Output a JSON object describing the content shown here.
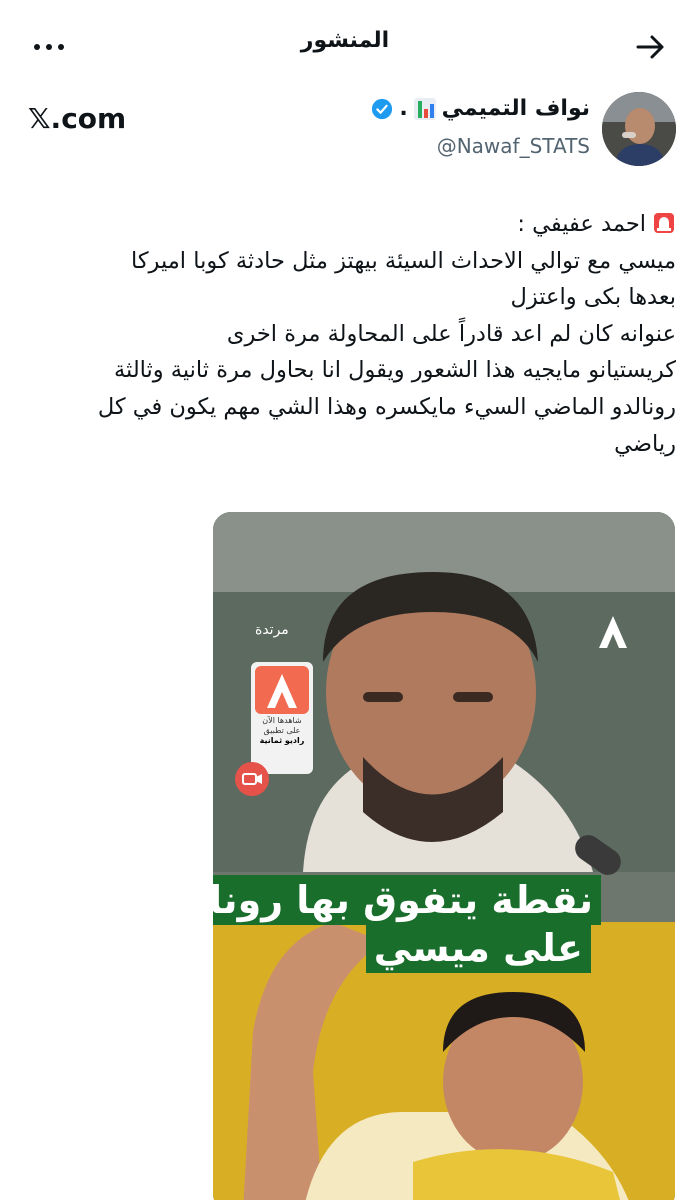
{
  "header": {
    "title": "المنشور",
    "back_icon": "arrow-right-icon",
    "more_icon": "more-options-icon"
  },
  "author": {
    "name": "نواف التميمي",
    "name_suffix": ".",
    "handle": "@Nawaf_STATS",
    "verified_color": "#1d9bf0",
    "stats_icon": "bar-chart-icon"
  },
  "watermark": {
    "logo_text": "𝕏.com"
  },
  "post": {
    "lines": [
      "احمد عفيفي :",
      "ميسي مع توالي الاحداث السيئة بيهتز مثل حادثة كوبا اميركا",
      "بعدها بكى واعتزل",
      "عنوانه كان لم اعد قادراً على المحاولة مرة اخرى",
      "كريستيانو مايجيه هذا الشعور ويقول انا بحاول مرة ثانية وثالثة",
      "رونالدو الماضي السيء مايكسره وهذا الشي مهم يكون في كل",
      "رياضي"
    ],
    "siren_icon": "rotating-light-icon"
  },
  "media": {
    "channel_label": "مرتدة",
    "app_watch_now": "شاهدها الآن",
    "app_on_app": "على تطبيق",
    "app_name": "راديو ثمانية",
    "headline_line1": "نقطة يتفوق بها رونالدو",
    "headline_line2": "على ميسي",
    "headline_bg": "#1a6e2c",
    "brand_color": "#f26a4f"
  }
}
